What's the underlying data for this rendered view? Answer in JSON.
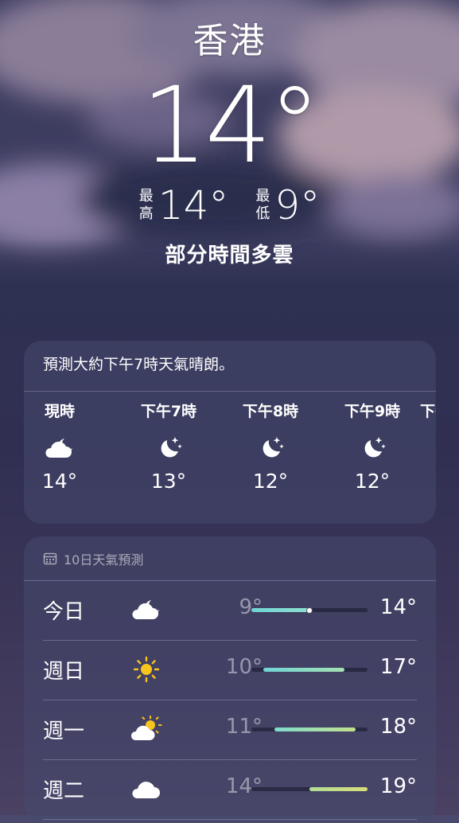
{
  "location": {
    "city": "香港",
    "current_temp": "14°",
    "high_label": [
      "最",
      "高"
    ],
    "high": "14°",
    "low_label": [
      "最",
      "低"
    ],
    "low": "9°",
    "condition": "部分時間多雲"
  },
  "hourly": {
    "summary": "預測大約下午7時天氣晴朗。",
    "items": [
      {
        "time": "現時",
        "icon": "partly-cloudy-night-icon",
        "temp": "14°"
      },
      {
        "time": "下午7時",
        "icon": "clear-night-icon",
        "temp": "13°"
      },
      {
        "time": "下午8時",
        "icon": "clear-night-icon",
        "temp": "12°"
      },
      {
        "time": "下午9時",
        "icon": "clear-night-icon",
        "temp": "12°"
      },
      {
        "time": "下午",
        "icon": "",
        "temp": ""
      }
    ]
  },
  "forecast": {
    "title": "10日天氣預測",
    "range_min": 9,
    "range_max": 19,
    "days": [
      {
        "day": "今日",
        "icon": "partly-cloudy-night-icon",
        "low": "9°",
        "high": "14°",
        "low_value": 9,
        "high_value": 14,
        "current_value": 14,
        "colors": [
          "#6fd6d6",
          "#8fe0cf"
        ]
      },
      {
        "day": "週日",
        "icon": "sun-icon",
        "low": "10°",
        "high": "17°",
        "low_value": 10,
        "high_value": 17,
        "colors": [
          "#6fd6d6",
          "#a6e0b3"
        ]
      },
      {
        "day": "週一",
        "icon": "partly-cloudy-day-icon",
        "low": "11°",
        "high": "18°",
        "low_value": 11,
        "high_value": 18,
        "colors": [
          "#7fdccc",
          "#c2e08e"
        ]
      },
      {
        "day": "週二",
        "icon": "cloud-icon",
        "low": "14°",
        "high": "19°",
        "low_value": 14,
        "high_value": 19,
        "colors": [
          "#b3dc95",
          "#d8dd7a"
        ]
      }
    ]
  }
}
